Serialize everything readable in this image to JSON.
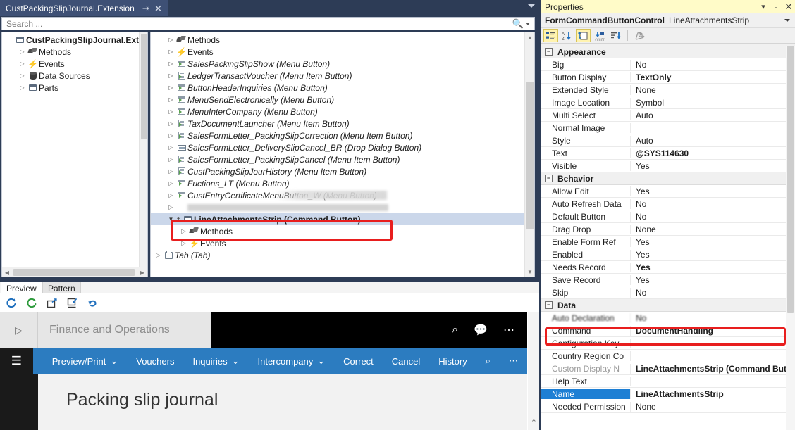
{
  "designer": {
    "document_tab": {
      "title": "CustPackingSlipJournal.Extension",
      "pin_icon": "pin-icon",
      "close_icon": "close-icon"
    },
    "search": {
      "placeholder": "Search ...",
      "icon": "search-icon"
    },
    "left_tree": [
      {
        "label": "CustPackingSlipJournal.Extensi",
        "icon": "form-icon",
        "arrow": "none",
        "indent": 0,
        "bold": true,
        "italic": false
      },
      {
        "label": "Methods",
        "icon": "methods-icon",
        "arrow": "closed",
        "indent": 1,
        "bold": false,
        "italic": false
      },
      {
        "label": "Events",
        "icon": "events-icon",
        "arrow": "closed",
        "indent": 1,
        "bold": false,
        "italic": false
      },
      {
        "label": "Data Sources",
        "icon": "datasource-icon",
        "arrow": "closed",
        "indent": 1,
        "bold": false,
        "italic": false
      },
      {
        "label": "Parts",
        "icon": "parts-icon",
        "arrow": "closed",
        "indent": 1,
        "bold": false,
        "italic": false
      }
    ],
    "right_tree": [
      {
        "label": "Methods",
        "icon": "methods-icon",
        "arrow": "closed",
        "indent": 1,
        "italic": false,
        "blurred": false
      },
      {
        "label": "Events",
        "icon": "events-icon",
        "arrow": "closed",
        "indent": 1,
        "italic": false,
        "blurred": false
      },
      {
        "label": "SalesPackingSlipShow (Menu Button)",
        "icon": "menubutton-icon",
        "arrow": "closed",
        "indent": 1,
        "italic": true,
        "blurred": false
      },
      {
        "label": "LedgerTransactVoucher (Menu Item Button)",
        "icon": "menuitem-icon",
        "arrow": "closed",
        "indent": 1,
        "italic": true,
        "blurred": false
      },
      {
        "label": "ButtonHeaderInquiries (Menu Button)",
        "icon": "menubutton-icon",
        "arrow": "closed",
        "indent": 1,
        "italic": true,
        "blurred": false
      },
      {
        "label": "MenuSendElectronically (Menu Button)",
        "icon": "menubutton-icon",
        "arrow": "closed",
        "indent": 1,
        "italic": true,
        "blurred": false
      },
      {
        "label": "MenuInterCompany (Menu Button)",
        "icon": "menubutton-icon",
        "arrow": "closed",
        "indent": 1,
        "italic": true,
        "blurred": false
      },
      {
        "label": "TaxDocumentLauncher (Menu Item Button)",
        "icon": "menuitem-icon",
        "arrow": "closed",
        "indent": 1,
        "italic": true,
        "blurred": false
      },
      {
        "label": "SalesFormLetter_PackingSlipCorrection (Menu Item Button)",
        "icon": "menuitem-icon",
        "arrow": "closed",
        "indent": 1,
        "italic": true,
        "blurred": false
      },
      {
        "label": "SalesFormLetter_DeliverySlipCancel_BR (Drop Dialog Button)",
        "icon": "dropdialog-icon",
        "arrow": "closed",
        "indent": 1,
        "italic": true,
        "blurred": false
      },
      {
        "label": "SalesFormLetter_PackingSlipCancel (Menu Item Button)",
        "icon": "menuitem-icon",
        "arrow": "closed",
        "indent": 1,
        "italic": true,
        "blurred": false
      },
      {
        "label": "CustPackingSlipJourHistory (Menu Item Button)",
        "icon": "menuitem-icon",
        "arrow": "closed",
        "indent": 1,
        "italic": true,
        "blurred": false
      },
      {
        "label": "Fuctions_LT (Menu Button)",
        "icon": "menubutton-icon",
        "arrow": "closed",
        "indent": 1,
        "italic": true,
        "blurred": false
      },
      {
        "label": "CustEntryCertificateMenuButton_W (Menu Button)",
        "icon": "menubutton-icon",
        "arrow": "closed",
        "indent": 1,
        "italic": true,
        "blurred": "partial"
      },
      {
        "label": "",
        "icon": "none",
        "arrow": "closed",
        "indent": 1,
        "italic": false,
        "blurred": true
      },
      {
        "label": "LineAttachmentsStrip (Command Button)",
        "icon": "commandbutton-icon",
        "arrow": "open",
        "indent": 1,
        "italic": false,
        "blurred": false,
        "selected": true,
        "bold": true
      },
      {
        "label": "Methods",
        "icon": "methods-icon",
        "arrow": "closed",
        "indent": 2,
        "italic": false,
        "blurred": false
      },
      {
        "label": "Events",
        "icon": "events-icon",
        "arrow": "closed",
        "indent": 2,
        "italic": false,
        "blurred": false
      },
      {
        "label": "Tab (Tab)",
        "icon": "tab-icon",
        "arrow": "closed",
        "indent": 0,
        "italic": true,
        "blurred": false
      }
    ],
    "highlight_color": "#e81e1e"
  },
  "preview": {
    "tabs": [
      {
        "label": "Preview",
        "active": true
      },
      {
        "label": "Pattern",
        "active": false
      }
    ],
    "toolbar": [
      {
        "icon": "refresh-icon"
      },
      {
        "icon": "refresh-green-icon"
      },
      {
        "icon": "open-external-icon"
      },
      {
        "icon": "dock-in-icon"
      },
      {
        "icon": "undo-icon"
      }
    ],
    "fo": {
      "app_title": "Finance and Operations",
      "expand_icon": "chevron-right-icon",
      "search_icon": "search-icon",
      "feedback_icon": "feedback-icon",
      "more_icon": "ellipsis-icon",
      "hamburger_icon": "hamburger-icon",
      "action_items": [
        {
          "label": "Preview/Print",
          "dropdown": true
        },
        {
          "label": "Vouchers",
          "dropdown": false
        },
        {
          "label": "Inquiries",
          "dropdown": true
        },
        {
          "label": "Intercompany",
          "dropdown": true
        },
        {
          "label": "Correct",
          "dropdown": false
        },
        {
          "label": "Cancel",
          "dropdown": false
        },
        {
          "label": "History",
          "dropdown": false
        }
      ],
      "action_search_icon": "search-icon",
      "action_more_icon": "ellipsis-icon",
      "page_heading": "Packing slip journal",
      "accent_color": "#2c7cc0"
    }
  },
  "properties": {
    "window_title": "Properties",
    "minimize_icon": "chevron-down-icon",
    "maximize_icon": "restore-icon",
    "close_icon": "close-icon",
    "object_type": "FormCommandButtonControl",
    "object_name": "LineAttachmentsStrip",
    "toolbar": [
      {
        "icon": "categorized-icon",
        "active": true
      },
      {
        "icon": "alphabetical-icon",
        "active": false
      },
      {
        "icon": "properties-icon",
        "active": true
      },
      {
        "icon": "property-pages-icon",
        "active": false
      },
      {
        "icon": "events-sort-icon",
        "active": false
      },
      {
        "icon": "wrench-icon",
        "active": false
      }
    ],
    "rows": [
      {
        "type": "category",
        "key": "Appearance"
      },
      {
        "type": "prop",
        "key": "Big",
        "value": "No",
        "bold": false
      },
      {
        "type": "prop",
        "key": "Button Display",
        "value": "TextOnly",
        "bold": true
      },
      {
        "type": "prop",
        "key": "Extended Style",
        "value": "None",
        "bold": false
      },
      {
        "type": "prop",
        "key": "Image Location",
        "value": "Symbol",
        "bold": false
      },
      {
        "type": "prop",
        "key": "Multi Select",
        "value": "Auto",
        "bold": false
      },
      {
        "type": "prop",
        "key": "Normal Image",
        "value": "",
        "bold": false
      },
      {
        "type": "prop",
        "key": "Style",
        "value": "Auto",
        "bold": false
      },
      {
        "type": "prop",
        "key": "Text",
        "value": "@SYS114630",
        "bold": true
      },
      {
        "type": "prop",
        "key": "Visible",
        "value": "Yes",
        "bold": false
      },
      {
        "type": "category",
        "key": "Behavior"
      },
      {
        "type": "prop",
        "key": "Allow Edit",
        "value": "Yes",
        "bold": false
      },
      {
        "type": "prop",
        "key": "Auto Refresh Data",
        "value": "No",
        "bold": false
      },
      {
        "type": "prop",
        "key": "Default Button",
        "value": "No",
        "bold": false
      },
      {
        "type": "prop",
        "key": "Drag Drop",
        "value": "None",
        "bold": false
      },
      {
        "type": "prop",
        "key": "Enable Form Ref",
        "value": "Yes",
        "bold": false
      },
      {
        "type": "prop",
        "key": "Enabled",
        "value": "Yes",
        "bold": false
      },
      {
        "type": "prop",
        "key": "Needs Record",
        "value": "Yes",
        "bold": true
      },
      {
        "type": "prop",
        "key": "Save Record",
        "value": "Yes",
        "bold": false
      },
      {
        "type": "prop",
        "key": "Skip",
        "value": "No",
        "bold": false
      },
      {
        "type": "category",
        "key": "Data"
      },
      {
        "type": "prop",
        "key": "Auto Declaration",
        "value": "No",
        "bold": false,
        "blurred": true
      },
      {
        "type": "prop",
        "key": "Command",
        "value": "DocumentHandling",
        "bold": true,
        "highlighted": true
      },
      {
        "type": "prop",
        "key": "Configuration Key",
        "value": "",
        "bold": false
      },
      {
        "type": "prop",
        "key": "Country Region Co",
        "value": "",
        "bold": false
      },
      {
        "type": "prop",
        "key": "Custom Display N",
        "value": "LineAttachmentsStrip (Command Buttor",
        "bold": true,
        "dim_key": true
      },
      {
        "type": "prop",
        "key": "Help Text",
        "value": "",
        "bold": false
      },
      {
        "type": "prop",
        "key": "Name",
        "value": "LineAttachmentsStrip",
        "bold": true,
        "selected": true
      },
      {
        "type": "prop",
        "key": "Needed Permission",
        "value": "None",
        "bold": false
      }
    ],
    "highlight_color": "#e81e1e",
    "selection_color": "#1e7fd4",
    "titlebar_color": "#fffbc8"
  }
}
